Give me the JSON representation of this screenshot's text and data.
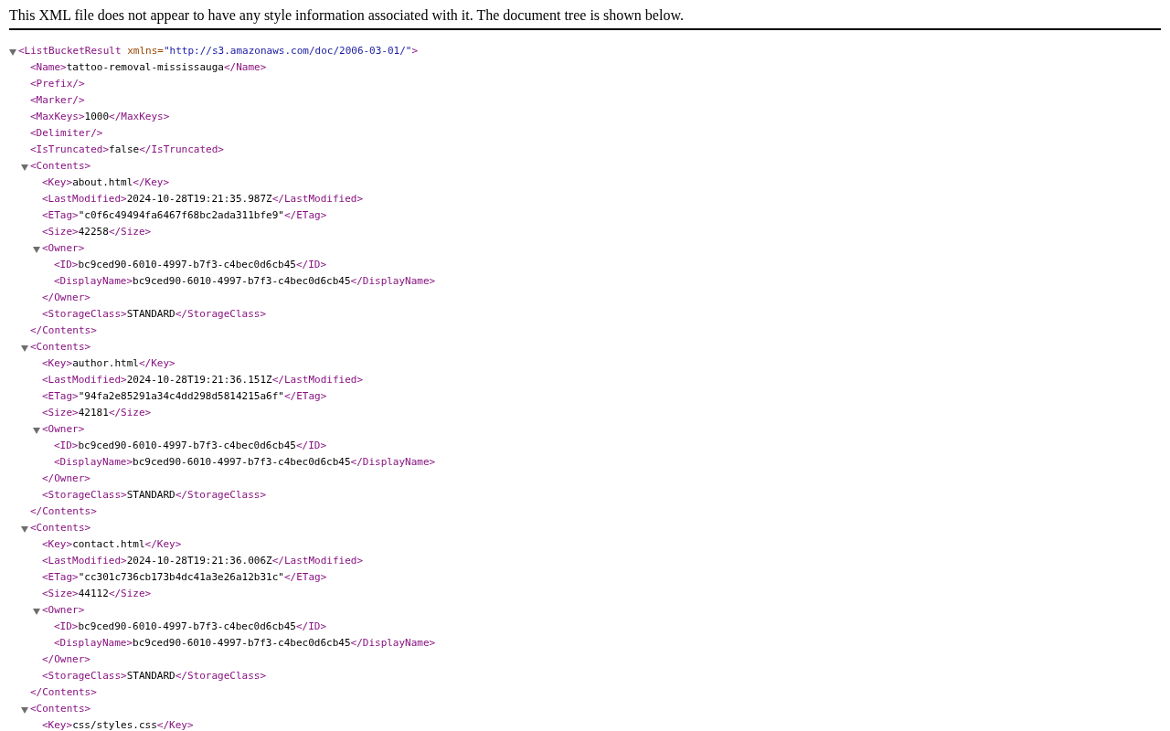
{
  "notice": "This XML file does not appear to have any style information associated with it. The document tree is shown below.",
  "tree": {
    "open": "<ListBucketResult",
    "attribute": {
      "name": "xmlns=",
      "value": "\"http://s3.amazonaws.com/doc/2006-03-01/\""
    },
    "open_end": ">",
    "expanded": true,
    "children": [
      {
        "open": "<Name>",
        "text": "tattoo-removal-mississauga",
        "close": "</Name>"
      },
      {
        "open": "<Prefix/>"
      },
      {
        "open": "<Marker/>"
      },
      {
        "open": "<MaxKeys>",
        "text": "1000",
        "close": "</MaxKeys>"
      },
      {
        "open": "<Delimiter/>"
      },
      {
        "open": "<IsTruncated>",
        "text": "false",
        "close": "</IsTruncated>"
      },
      {
        "open": "<Contents>",
        "expanded": true,
        "close": "</Contents>",
        "children": [
          {
            "open": "<Key>",
            "text": "about.html",
            "close": "</Key>"
          },
          {
            "open": "<LastModified>",
            "text": "2024-10-28T19:21:35.987Z",
            "close": "</LastModified>"
          },
          {
            "open": "<ETag>",
            "text": "\"c0f6c49494fa6467f68bc2ada311bfe9\"",
            "close": "</ETag>"
          },
          {
            "open": "<Size>",
            "text": "42258",
            "close": "</Size>"
          },
          {
            "open": "<Owner>",
            "expanded": true,
            "close": "</Owner>",
            "children": [
              {
                "open": "<ID>",
                "text": "bc9ced90-6010-4997-b7f3-c4bec0d6cb45",
                "close": "</ID>"
              },
              {
                "open": "<DisplayName>",
                "text": "bc9ced90-6010-4997-b7f3-c4bec0d6cb45",
                "close": "</DisplayName>"
              }
            ]
          },
          {
            "open": "<StorageClass>",
            "text": "STANDARD",
            "close": "</StorageClass>"
          }
        ]
      },
      {
        "open": "<Contents>",
        "expanded": true,
        "close": "</Contents>",
        "children": [
          {
            "open": "<Key>",
            "text": "author.html",
            "close": "</Key>"
          },
          {
            "open": "<LastModified>",
            "text": "2024-10-28T19:21:36.151Z",
            "close": "</LastModified>"
          },
          {
            "open": "<ETag>",
            "text": "\"94fa2e85291a34c4dd298d5814215a6f\"",
            "close": "</ETag>"
          },
          {
            "open": "<Size>",
            "text": "42181",
            "close": "</Size>"
          },
          {
            "open": "<Owner>",
            "expanded": true,
            "close": "</Owner>",
            "children": [
              {
                "open": "<ID>",
                "text": "bc9ced90-6010-4997-b7f3-c4bec0d6cb45",
                "close": "</ID>"
              },
              {
                "open": "<DisplayName>",
                "text": "bc9ced90-6010-4997-b7f3-c4bec0d6cb45",
                "close": "</DisplayName>"
              }
            ]
          },
          {
            "open": "<StorageClass>",
            "text": "STANDARD",
            "close": "</StorageClass>"
          }
        ]
      },
      {
        "open": "<Contents>",
        "expanded": true,
        "close": "</Contents>",
        "children": [
          {
            "open": "<Key>",
            "text": "contact.html",
            "close": "</Key>"
          },
          {
            "open": "<LastModified>",
            "text": "2024-10-28T19:21:36.006Z",
            "close": "</LastModified>"
          },
          {
            "open": "<ETag>",
            "text": "\"cc301c736cb173b4dc41a3e26a12b31c\"",
            "close": "</ETag>"
          },
          {
            "open": "<Size>",
            "text": "44112",
            "close": "</Size>"
          },
          {
            "open": "<Owner>",
            "expanded": true,
            "close": "</Owner>",
            "children": [
              {
                "open": "<ID>",
                "text": "bc9ced90-6010-4997-b7f3-c4bec0d6cb45",
                "close": "</ID>"
              },
              {
                "open": "<DisplayName>",
                "text": "bc9ced90-6010-4997-b7f3-c4bec0d6cb45",
                "close": "</DisplayName>"
              }
            ]
          },
          {
            "open": "<StorageClass>",
            "text": "STANDARD",
            "close": "</StorageClass>"
          }
        ]
      },
      {
        "open": "<Contents>",
        "expanded": true,
        "children": [
          {
            "open": "<Key>",
            "text": "css/styles.css",
            "close": "</Key>"
          }
        ]
      }
    ]
  }
}
